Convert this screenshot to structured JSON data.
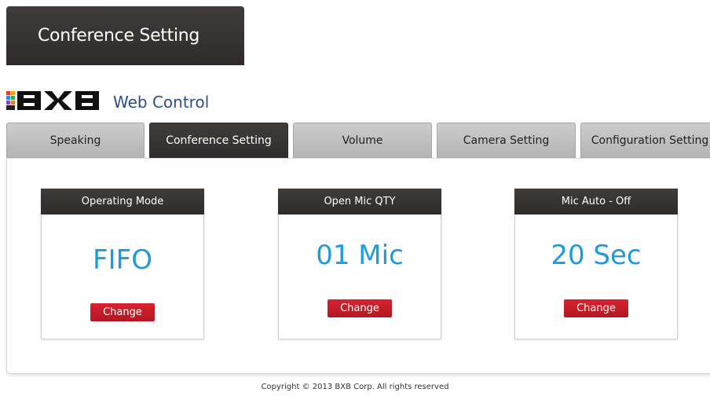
{
  "header": {
    "title": "Conference Setting"
  },
  "brand": {
    "title": "Web Control"
  },
  "tabs": [
    {
      "label": "Speaking"
    },
    {
      "label": "Conference Setting"
    },
    {
      "label": "Volume"
    },
    {
      "label": "Camera Setting"
    },
    {
      "label": "Configuration Setting"
    }
  ],
  "active_tab": "Conference Setting",
  "cards": [
    {
      "title": "Operating Mode",
      "value": "FIFO",
      "button": "Change"
    },
    {
      "title": "Open Mic QTY",
      "value": "01 Mic",
      "button": "Change"
    },
    {
      "title": "Mic Auto - Off",
      "value": "20 Sec",
      "button": "Change"
    }
  ],
  "footer": {
    "copyright": "Copyright © 2013 BXB Corp. All rights reserved"
  },
  "colors": {
    "header_dark": "#3a3736",
    "accent_blue": "#1e9ae0",
    "button_red": "#c41e2a",
    "brand_blue": "#2b4f86"
  }
}
